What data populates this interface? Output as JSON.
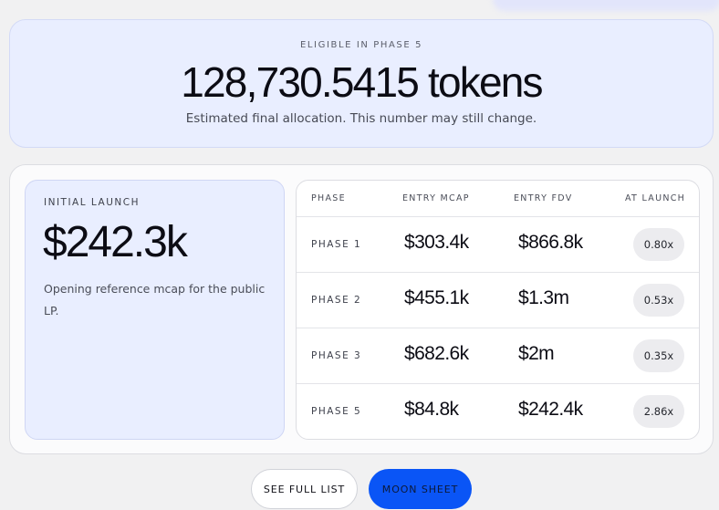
{
  "hero": {
    "eyebrow": "ELIGIBLE IN PHASE 5",
    "amount": "128,730.5415 tokens",
    "note": "Estimated final allocation. This number may still change."
  },
  "launch": {
    "eyebrow": "INITIAL LAUNCH",
    "amount": "$242.3k",
    "note": "Opening reference mcap for the public LP."
  },
  "table": {
    "headers": {
      "phase": "PHASE",
      "entry_mcap": "ENTRY MCAP",
      "entry_fdv": "ENTRY FDV",
      "at_launch": "AT LAUNCH"
    },
    "rows": [
      {
        "phase": "PHASE 1",
        "mcap": "$303.4k",
        "fdv": "$866.8k",
        "multiple": "0.80x"
      },
      {
        "phase": "PHASE 2",
        "mcap": "$455.1k",
        "fdv": "$1.3m",
        "multiple": "0.53x"
      },
      {
        "phase": "PHASE 3",
        "mcap": "$682.6k",
        "fdv": "$2m",
        "multiple": "0.35x"
      },
      {
        "phase": "PHASE 5",
        "mcap": "$84.8k",
        "fdv": "$242.4k",
        "multiple": "2.86x"
      }
    ]
  },
  "actions": {
    "see_full_list": "SEE FULL LIST",
    "moon_sheet": "MOON SHEET"
  },
  "colors": {
    "accent": "#0a55f6",
    "card_tint": "#e9eeff",
    "background": "#f1f1f2"
  }
}
